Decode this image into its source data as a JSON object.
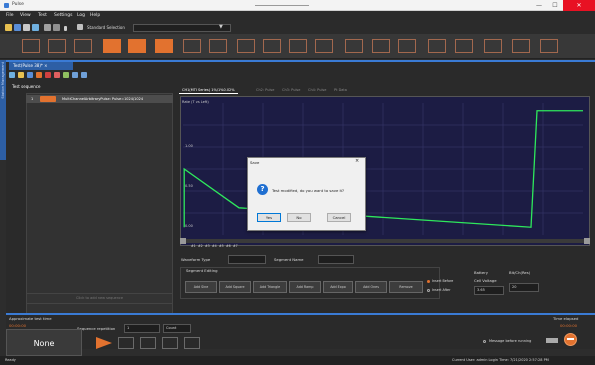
{
  "window": {
    "title": "Pulse",
    "minimize": "—",
    "maximize": "☐",
    "close": "✕"
  },
  "menu": [
    "File",
    "View",
    "Test",
    "Settings",
    "Log",
    "Help"
  ],
  "toolbar": {
    "standard_label": "Standard Selection",
    "dropdown_value": "",
    "dropdown_arrow": "▼"
  },
  "side_tab": {
    "label": "Station Management"
  },
  "document_tab": {
    "label": "Test(Pulse 38)* ×"
  },
  "test_sequence": {
    "heading": "Test sequence",
    "rows": [
      {
        "num": "1",
        "name": "MultiChannelArbitraryPulse: Pulse=1024/1024"
      }
    ],
    "add_new": "Click to add new sequence"
  },
  "chart_tabs": [
    {
      "label": "CH1(MTI Series) 1%/1%0.02%",
      "active": true
    },
    {
      "label": "Ch2: Pulse",
      "active": false
    },
    {
      "label": "Ch3: Pulse",
      "active": false
    },
    {
      "label": "Ch4: Pulse",
      "active": false
    },
    {
      "label": "Pt Data",
      "active": false
    }
  ],
  "chart_data": {
    "type": "line",
    "title": "Rate (T vs Left)",
    "xlabel": "",
    "ylabel": "",
    "x_ticks": [
      "#1",
      "#2",
      "#3",
      "#4",
      "#5",
      "#6",
      "#7"
    ],
    "y_ticks": [
      "1.00",
      "0.50",
      "0.00"
    ],
    "series": [
      {
        "color": "#2ee85c",
        "points": [
          [
            0.3,
            0
          ],
          [
            0.3,
            1.5
          ],
          [
            14,
            0.5
          ],
          [
            87,
            0
          ],
          [
            88.5,
            3.0
          ],
          [
            100,
            3.0
          ]
        ]
      }
    ],
    "xlim": [
      0,
      100
    ],
    "ylim": [
      -0.2,
      3.2
    ]
  },
  "waveform": {
    "type_label": "Waveform Type",
    "type_value": "",
    "segment_name_label": "Segment Name",
    "segment_name_value": ""
  },
  "segment_editing": {
    "heading": "Segment Editing",
    "buttons": [
      "Add Sine",
      "Add Square",
      "Add Triangle",
      "Add Ramp",
      "Add Expo",
      "Add Ones",
      "Remove"
    ],
    "radio_before": "Insert Before",
    "radio_after": "Insert After"
  },
  "battery": {
    "label": "Battery",
    "cell_voltage_label": "Cell Voltage",
    "cell_voltage_value": "3.65",
    "bits_label": "Bit/Ch(Res)",
    "bits_value": "20"
  },
  "approx_test_time": {
    "label": "Approximate test time",
    "value": "00:00:00"
  },
  "time_elapsed": {
    "label": "Time elapsed",
    "value": "00:00:00"
  },
  "sequence_repetition": {
    "label": "Sequence repetition",
    "value": "1",
    "unit": "Count"
  },
  "none_button": "None",
  "message_before_running": "Message before running",
  "status": {
    "left": "Ready",
    "right": "Current User: admin  Login Time: 7/21/2020 2:57:28 PM"
  },
  "dialog": {
    "title": "Save",
    "message": "Test modified, do you want to save it?",
    "buttons": [
      "Yes",
      "No",
      "Cancel"
    ]
  }
}
